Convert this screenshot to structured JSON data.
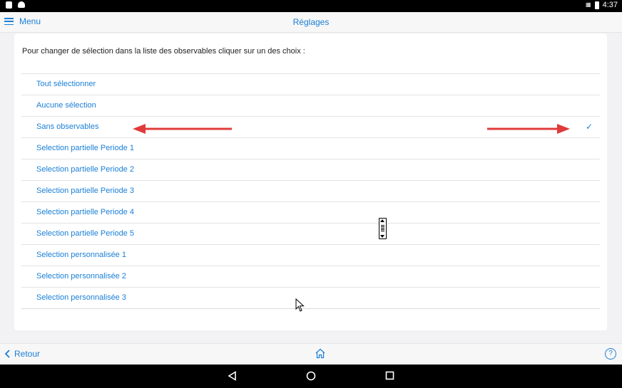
{
  "status_bar": {
    "time": "4:37",
    "left_icons": [
      "sd-card-icon",
      "android-icon"
    ],
    "right_icons": [
      "no-sim-icon",
      "battery-icon"
    ]
  },
  "header": {
    "menu_label": "Menu",
    "title": "Réglages"
  },
  "content": {
    "instruction": "Pour changer de sélection dans la liste des observables cliquer sur un des choix :",
    "options": [
      {
        "label": "Tout sélectionner",
        "selected": false
      },
      {
        "label": "Aucune sélection",
        "selected": false
      },
      {
        "label": "Sans observables",
        "selected": true
      },
      {
        "label": "Selection partielle Periode 1",
        "selected": false
      },
      {
        "label": "Selection partielle Periode 2",
        "selected": false
      },
      {
        "label": "Selection partielle Periode 3",
        "selected": false
      },
      {
        "label": "Selection partielle Periode 4",
        "selected": false
      },
      {
        "label": "Selection partielle Periode 5",
        "selected": false
      },
      {
        "label": "Selection personnalisée 1",
        "selected": false
      },
      {
        "label": "Selection personnalisée 2",
        "selected": false
      },
      {
        "label": "Selection personnalisée 3",
        "selected": false
      }
    ],
    "check_mark": "✓"
  },
  "footer": {
    "back_label": "Retour",
    "help_label": "?"
  },
  "colors": {
    "accent": "#1a7fd6",
    "annotation_arrow": "#e03a3a"
  }
}
